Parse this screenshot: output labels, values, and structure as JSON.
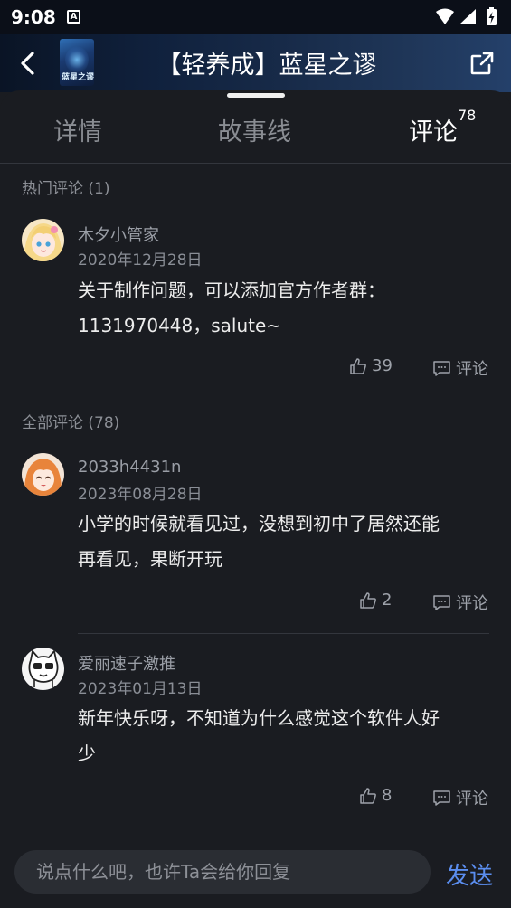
{
  "status_bar": {
    "time": "9:08",
    "notif_badge": "A"
  },
  "header": {
    "title": "【轻养成】蓝星之谬",
    "cover_text": "蓝星之谬"
  },
  "tabs": [
    {
      "label": "详情"
    },
    {
      "label": "故事线"
    },
    {
      "label": "评论",
      "count": "78"
    }
  ],
  "hot_section": {
    "label": "热门评论 (1)"
  },
  "all_section": {
    "label": "全部评论 (78)"
  },
  "comments": [
    {
      "user": "木夕小管家",
      "date": "2020年12月28日",
      "lines": [
        "关于制作问题，可以添加官方作者群：",
        "1131970448，salute~"
      ],
      "likes": "39",
      "reply_label": "评论"
    },
    {
      "user": "2033h4431n",
      "date": "2023年08月28日",
      "lines": [
        "小学的时候就看见过，没想到初中了居然还能",
        "再看见，果断开玩"
      ],
      "likes": "2",
      "reply_label": "评论"
    },
    {
      "user": "爱丽速子激推",
      "date": "2023年01月13日",
      "lines": [
        "新年快乐呀，不知道为什么感觉这个软件人好",
        "少"
      ],
      "likes": "8",
      "reply_label": "评论"
    }
  ],
  "input": {
    "placeholder": "说点什么吧，也许Ta会给你回复",
    "send_label": "发送"
  },
  "colors": {
    "accent": "#5b8ef0",
    "background": "#1a1c21",
    "header": "#10213d"
  }
}
